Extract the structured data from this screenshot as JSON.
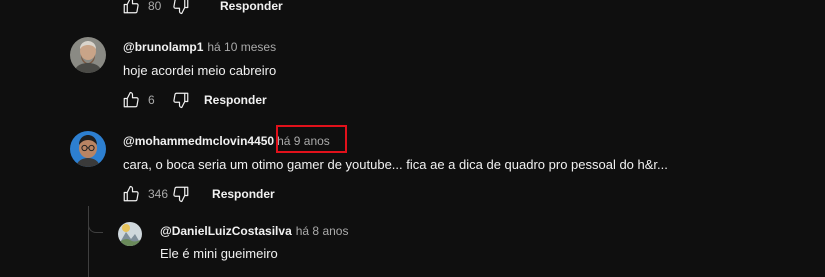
{
  "top_actions": {
    "likes": "80",
    "reply_label": "Responder"
  },
  "comments": [
    {
      "author": "@brunolamp1",
      "time": "há 10 meses",
      "text": "hoje acordei meio cabreiro",
      "likes": "6",
      "reply_label": "Responder"
    },
    {
      "author": "@mohammedmclovin4450",
      "time": "há 9 anos",
      "text": "cara, o boca seria um otimo gamer de youtube... fica ae a dica de quadro pro pessoal do h&r...",
      "likes": "346",
      "reply_label": "Responder"
    }
  ],
  "reply": {
    "author": "@DanielLuizCostasilva",
    "time": "há 8 anos",
    "text": "Ele é mini gueimeiro"
  },
  "colors": {
    "background": "#0f0f0f",
    "highlight": "#e1111b",
    "secondary_text": "#aaaaaa"
  },
  "icons": [
    "thumbs-up-icon",
    "thumbs-down-icon"
  ]
}
